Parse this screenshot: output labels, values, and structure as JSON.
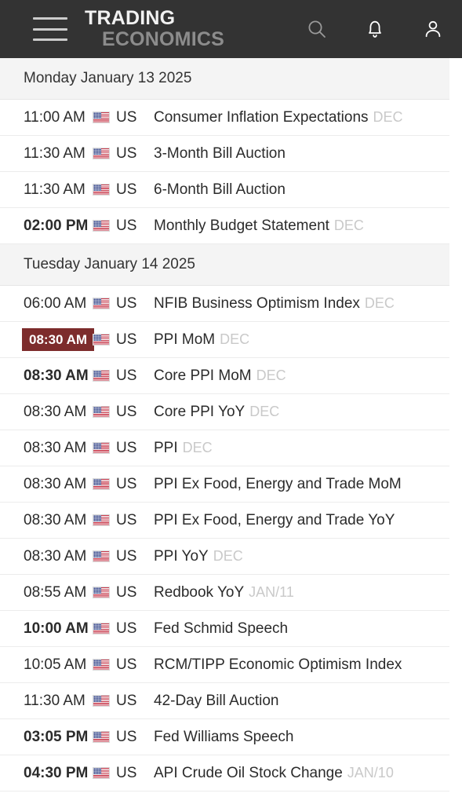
{
  "header": {
    "menu_label": "Menu",
    "logo_line1": "TRADING",
    "logo_line2": "ECONOMICS",
    "icons": {
      "search": "search-icon",
      "alerts": "bell-icon",
      "account": "user-icon"
    },
    "background_color": "#333333",
    "logo_color_primary": "#f2f2f2",
    "logo_color_secondary": "#8c8c8c"
  },
  "calendar": {
    "highlight_color": "#7d2c2c",
    "section_header_bg": "#f4f4f4",
    "sections": [
      {
        "date_label": "Monday January 13 2025",
        "rows": [
          {
            "time": "11:00 AM",
            "bold": false,
            "highlighted": false,
            "country": "US",
            "flag": "us-flag-icon",
            "event": "Consumer Inflation Expectations",
            "reference": "DEC"
          },
          {
            "time": "11:30 AM",
            "bold": false,
            "highlighted": false,
            "country": "US",
            "flag": "us-flag-icon",
            "event": "3-Month Bill Auction",
            "reference": ""
          },
          {
            "time": "11:30 AM",
            "bold": false,
            "highlighted": false,
            "country": "US",
            "flag": "us-flag-icon",
            "event": "6-Month Bill Auction",
            "reference": ""
          },
          {
            "time": "02:00 PM",
            "bold": true,
            "highlighted": false,
            "country": "US",
            "flag": "us-flag-icon",
            "event": "Monthly Budget Statement",
            "reference": "DEC"
          }
        ]
      },
      {
        "date_label": "Tuesday January 14 2025",
        "rows": [
          {
            "time": "06:00 AM",
            "bold": false,
            "highlighted": false,
            "country": "US",
            "flag": "us-flag-icon",
            "event": "NFIB Business Optimism Index",
            "reference": "DEC"
          },
          {
            "time": "08:30 AM",
            "bold": true,
            "highlighted": true,
            "country": "US",
            "flag": "us-flag-icon",
            "event": "PPI MoM",
            "reference": "DEC"
          },
          {
            "time": "08:30 AM",
            "bold": true,
            "highlighted": false,
            "country": "US",
            "flag": "us-flag-icon",
            "event": "Core PPI MoM",
            "reference": "DEC"
          },
          {
            "time": "08:30 AM",
            "bold": false,
            "highlighted": false,
            "country": "US",
            "flag": "us-flag-icon",
            "event": "Core PPI YoY",
            "reference": "DEC"
          },
          {
            "time": "08:30 AM",
            "bold": false,
            "highlighted": false,
            "country": "US",
            "flag": "us-flag-icon",
            "event": "PPI",
            "reference": "DEC"
          },
          {
            "time": "08:30 AM",
            "bold": false,
            "highlighted": false,
            "country": "US",
            "flag": "us-flag-icon",
            "event": "PPI Ex Food, Energy and Trade MoM",
            "reference": ""
          },
          {
            "time": "08:30 AM",
            "bold": false,
            "highlighted": false,
            "country": "US",
            "flag": "us-flag-icon",
            "event": "PPI Ex Food, Energy and Trade YoY",
            "reference": ""
          },
          {
            "time": "08:30 AM",
            "bold": false,
            "highlighted": false,
            "country": "US",
            "flag": "us-flag-icon",
            "event": "PPI YoY",
            "reference": "DEC"
          },
          {
            "time": "08:55 AM",
            "bold": false,
            "highlighted": false,
            "country": "US",
            "flag": "us-flag-icon",
            "event": "Redbook YoY",
            "reference": "JAN/11"
          },
          {
            "time": "10:00 AM",
            "bold": true,
            "highlighted": false,
            "country": "US",
            "flag": "us-flag-icon",
            "event": "Fed Schmid Speech",
            "reference": ""
          },
          {
            "time": "10:05 AM",
            "bold": false,
            "highlighted": false,
            "country": "US",
            "flag": "us-flag-icon",
            "event": "RCM/TIPP Economic Optimism Index",
            "reference": ""
          },
          {
            "time": "11:30 AM",
            "bold": false,
            "highlighted": false,
            "country": "US",
            "flag": "us-flag-icon",
            "event": "42-Day Bill Auction",
            "reference": ""
          },
          {
            "time": "03:05 PM",
            "bold": true,
            "highlighted": false,
            "country": "US",
            "flag": "us-flag-icon",
            "event": "Fed Williams Speech",
            "reference": ""
          },
          {
            "time": "04:30 PM",
            "bold": true,
            "highlighted": false,
            "country": "US",
            "flag": "us-flag-icon",
            "event": "API Crude Oil Stock Change",
            "reference": "JAN/10"
          }
        ]
      }
    ]
  }
}
